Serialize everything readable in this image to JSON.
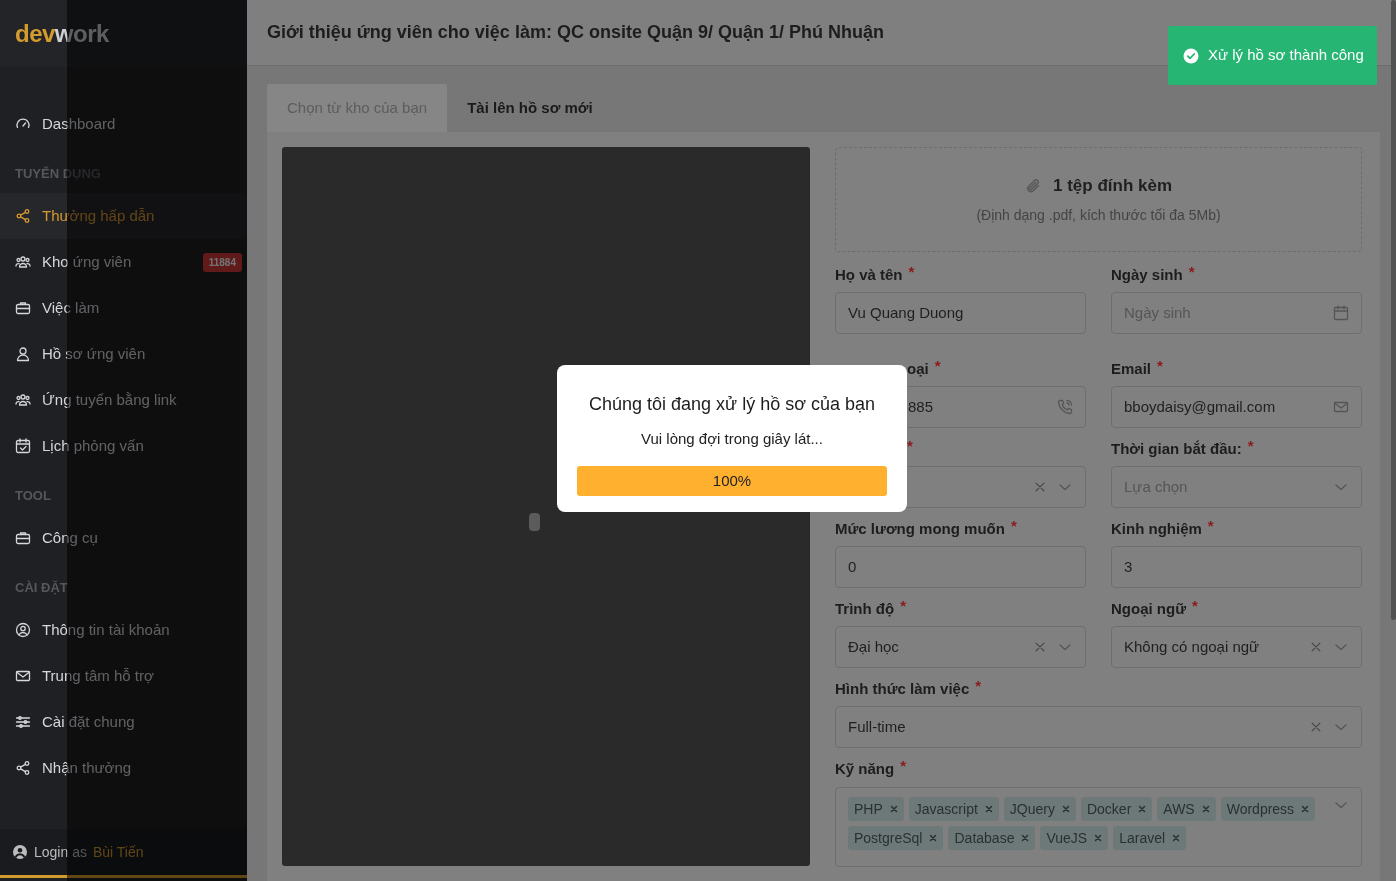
{
  "sidebar": {
    "logo": {
      "accent": "dev",
      "rest": "work"
    },
    "groups": [
      {
        "items": [
          {
            "label": "Dashboard",
            "selected": false
          }
        ]
      },
      {
        "title": "TUYỂN DỤNG",
        "items": [
          {
            "label": "Thưởng hấp dẫn",
            "selected": true
          },
          {
            "label": "Kho ứng viên",
            "selected": false,
            "badge": "11884"
          },
          {
            "label": "Việc làm",
            "selected": false
          },
          {
            "label": "Hồ sơ ứng viên",
            "selected": false
          },
          {
            "label": "Ứng tuyển bằng link",
            "selected": false
          },
          {
            "label": "Lịch phỏng vấn",
            "selected": false
          }
        ]
      },
      {
        "title": "TOOL",
        "items": [
          {
            "label": "Công cụ",
            "selected": false
          }
        ]
      },
      {
        "title": "CÀI ĐẶT",
        "items": [
          {
            "label": "Thông tin tài khoản",
            "selected": false
          },
          {
            "label": "Trung tâm hỗ trợ",
            "selected": false
          },
          {
            "label": "Cài đặt chung",
            "selected": false
          },
          {
            "label": "Nhận thưởng",
            "selected": false
          }
        ]
      }
    ],
    "footer": {
      "prefix": "Login as",
      "user": "Bùi Tiến"
    }
  },
  "drawer": {
    "title": "Giới thiệu ứng viên cho việc làm: QC onsite Quận 9/ Quận 1/ Phú Nhuận",
    "tabs": [
      {
        "label": "Chọn từ kho của bạn",
        "selected": false
      },
      {
        "label": "Tài lên hồ sơ mới",
        "selected": true
      }
    ],
    "upload": {
      "title": "1 tệp đính kèm",
      "hint": "(Định dạng .pdf, kích thước tối đa 5Mb)"
    },
    "fields": [
      {
        "kind": "text",
        "label": "Họ và tên",
        "mark": "*",
        "value": "Vu Quang Duong"
      },
      {
        "kind": "date",
        "label": "Ngày sinh",
        "mark": "*",
        "placeholder": "Ngày sinh"
      },
      {
        "kind": "phone",
        "label": "oại",
        "mark": "*",
        "value": "885",
        "covered": true
      },
      {
        "kind": "email",
        "label": "Email",
        "mark": "*",
        "value": "bboydaisy@gmail.com"
      },
      {
        "kind": "select",
        "mark": "*",
        "clearable": true,
        "covered": true
      },
      {
        "kind": "select",
        "label": "Thời gian bắt đầu:",
        "mark": "*",
        "placeholder": "Lựa chọn",
        "clearable": false
      },
      {
        "kind": "text",
        "label": "Mức lương mong muốn",
        "mark": "*",
        "value": "0"
      },
      {
        "kind": "text",
        "label": "Kinh nghiệm",
        "mark": "*",
        "value": "3"
      },
      {
        "kind": "select",
        "label": "Trình độ",
        "mark": "*",
        "value": "Đại học",
        "clearable": true
      },
      {
        "kind": "select",
        "label": "Ngoại ngữ",
        "mark": "*",
        "value": "Không có ngoại ngữ",
        "clearable": true
      },
      {
        "kind": "select",
        "label": "Hình thức làm việc",
        "mark": "*",
        "value": "Full-time",
        "clearable": true,
        "full": true
      },
      {
        "kind": "tags",
        "label": "Kỹ năng",
        "mark": "*",
        "full": true,
        "tags": [
          "PHP",
          "Javascript",
          "JQuery",
          "Docker",
          "AWS",
          "Wordpress",
          "PostgreSql",
          "Database",
          "VueJS",
          "Laravel"
        ]
      }
    ]
  },
  "modal": {
    "title": "Chúng tôi đang xử lý hồ sơ của bạn",
    "message": "Vui lòng đợi trong giây lát...",
    "progress": {
      "level": 1,
      "label": "100%"
    }
  },
  "toast": {
    "message": "Xử lý hồ sơ thành công"
  }
}
